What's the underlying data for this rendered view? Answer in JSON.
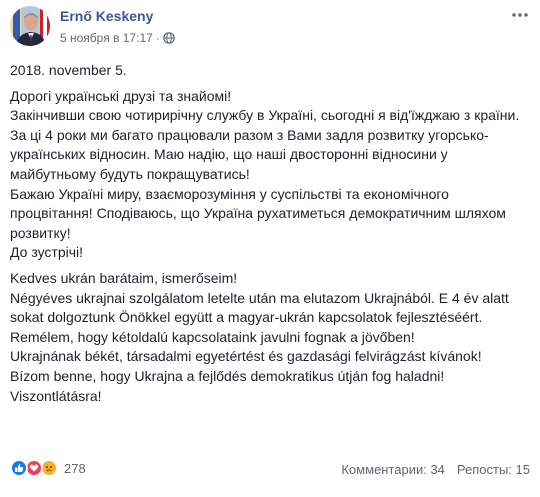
{
  "post": {
    "author": "Ernő Keskeny",
    "timestamp": "5 ноября в 17:17",
    "separator": "·",
    "date_line": "2018. november 5.",
    "ukrainian_text": "Дорогі українські друзі та знайомі!\nЗакінчивши свою чотирирічну службу в Україні, сьогодні я від'їжджаю з країни. За ці 4 роки ми багато працювали разом з Вами задля розвитку угорсько-українських відносин. Маю надію, що наші двосторонні відносини у майбутньому будуть покращуватись!\nБажаю Україні миру, взаєморозуміння у суспільстві та економічного процвітання! Сподіваюсь, що Україна рухатиметься демократичним шляхом розвитку!\nДо зустрічі!",
    "hungarian_text": "Kedves ukrán barátaim, ismerőseim!\nNégyéves ukrajnai szolgálatom letelte után ma elutazom Ukrajnából. E 4 év alatt sokat dolgoztunk Önökkel együtt a magyar-ukrán kapcsolatok fejlesztéséért. Remélem, hogy kétoldalú kapcsolataink javulni fognak a jövőben!\nUkrajnának békét, társadalmi egyetértést és gazdasági felvirágzást kívánok!\nBízom benne, hogy Ukrajna a fejlődés demokratikus útján fog haladni!\nViszontlátásra!"
  },
  "footer": {
    "reaction_count": "278",
    "comments": "Комментарии: 34",
    "shares": "Репосты: 15"
  },
  "colors": {
    "author_link": "#385898",
    "meta_text": "#616770",
    "like": "#1877f2",
    "love": "#f33e58",
    "sad": "#f7b125"
  },
  "icons": {
    "avatar": "avatar-photo",
    "globe": "globe-icon",
    "more": "more-options-icon",
    "reactions": [
      "like-icon",
      "love-icon",
      "sad-icon"
    ]
  }
}
